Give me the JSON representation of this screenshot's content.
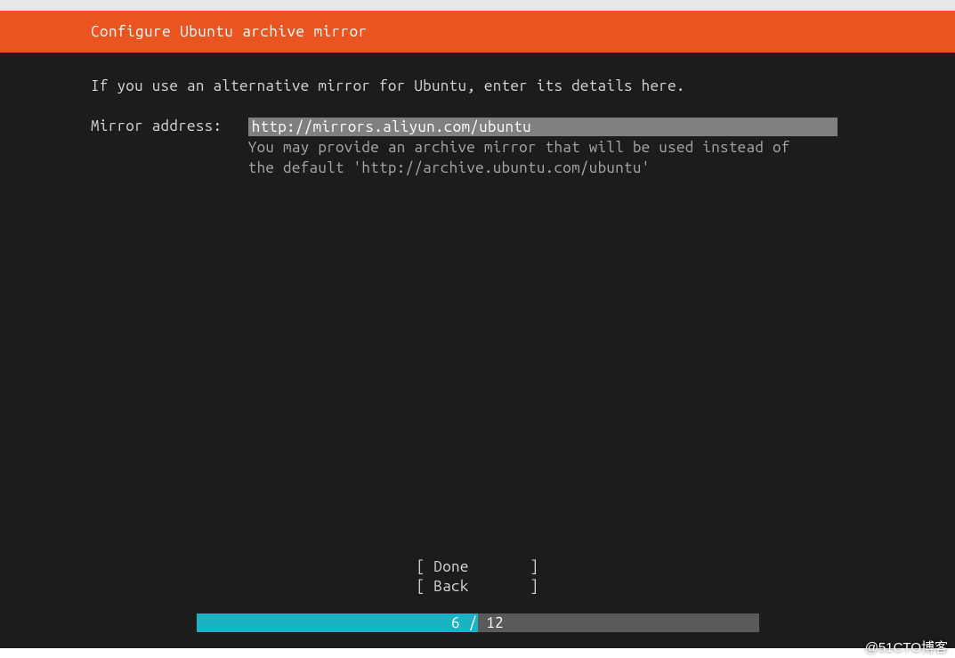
{
  "header": {
    "title": "Configure Ubuntu archive mirror"
  },
  "body": {
    "instruction": "If you use an alternative mirror for Ubuntu, enter its details here.",
    "field_label": "Mirror address:   ",
    "mirror_value": "http://mirrors.aliyun.com/ubuntu",
    "help_line1": "You may provide an archive mirror that will be used instead of",
    "help_line2": "the default 'http://archive.ubuntu.com/ubuntu'"
  },
  "buttons": {
    "done": "[ Done       ]",
    "back": "[ Back       ]"
  },
  "progress": {
    "current": 6,
    "total": 12,
    "text": "6 / 12",
    "percent": 50
  },
  "watermark": "@51CTO博客"
}
